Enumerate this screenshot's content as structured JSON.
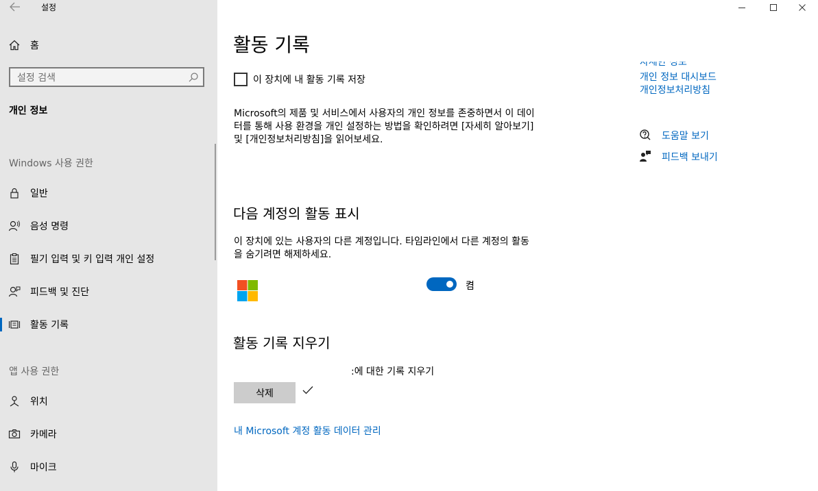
{
  "window": {
    "title": "설정",
    "minimize_icon": "minimize-icon",
    "maximize_icon": "maximize-icon",
    "close_icon": "close-icon"
  },
  "sidebar": {
    "home_label": "홈",
    "search_placeholder": "설정 검색",
    "category_title": "개인 정보",
    "windows_section": "Windows 사용 권한",
    "windows_items": [
      {
        "label": "일반",
        "icon": "lock-icon"
      },
      {
        "label": "음성 명령",
        "icon": "speech-icon"
      },
      {
        "label": "필기 입력 및 키 입력 개인 설정",
        "icon": "clipboard-icon"
      },
      {
        "label": "피드백 및 진단",
        "icon": "feedback-person-icon"
      },
      {
        "label": "활동 기록",
        "icon": "timeline-icon",
        "selected": true
      }
    ],
    "app_section": "앱 사용 권한",
    "app_items": [
      {
        "label": "위치",
        "icon": "location-icon"
      },
      {
        "label": "카메라",
        "icon": "camera-icon"
      },
      {
        "label": "마이크",
        "icon": "microphone-icon"
      }
    ]
  },
  "main": {
    "title": "활동 기록",
    "store_checkbox_label": "이 장치에 내 활동 기록 저장",
    "store_checkbox_checked": false,
    "description": "Microsoft의 제품 및 서비스에서 사용자의 개인 정보를 존중하면서 이 데이터를 통해 사용 환경을 개인 설정하는 방법을 확인하려면 [자세히 알아보기] 및 [개인정보처리방침]을 읽어보세요.",
    "accounts_heading": "다음 계정의 활동 표시",
    "accounts_description": "이 장치에 있는 사용자의 다른 계정입니다. 타임라인에서 다른 계정의 활동을 숨기려면 해제하세요.",
    "account_toggle_label": "켬",
    "account_toggle_on": true,
    "clear_heading": "활동 기록 지우기",
    "clear_description": ":에 대한 기록 지우기",
    "delete_button": "삭제",
    "manage_link": "내 Microsoft 계정 활동 데이터 관리"
  },
  "right_panel": {
    "partial_link": "자세한 정보",
    "dashboard_link": "개인 정보 대시보드",
    "privacy_link": "개인정보처리방침",
    "help_link": "도움말 보기",
    "feedback_link": "피드백 보내기"
  },
  "colors": {
    "accent": "#0067c0",
    "sidebar_bg": "#e6e6e6",
    "ms_red": "#f25022",
    "ms_green": "#7fba00",
    "ms_blue": "#00a4ef",
    "ms_yellow": "#ffb900"
  }
}
